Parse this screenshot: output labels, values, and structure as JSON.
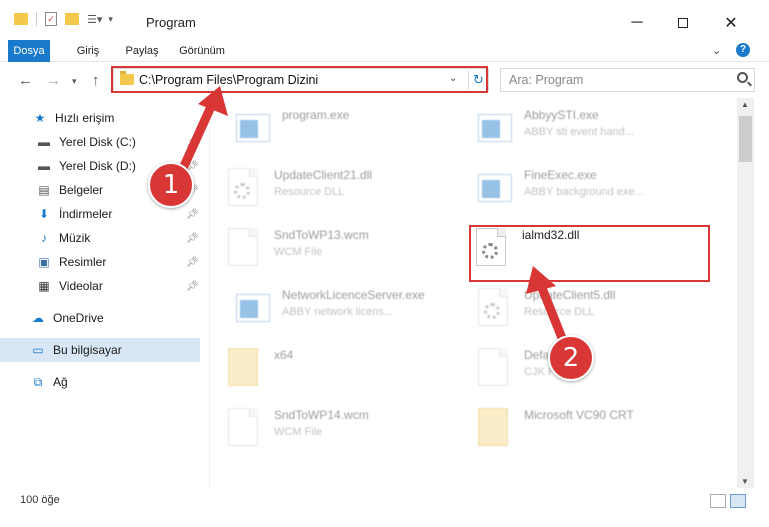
{
  "window": {
    "title": "Program",
    "minimize_icon": "minimize-icon",
    "maximize_icon": "maximize-icon",
    "close_icon": "close-icon"
  },
  "ribbon": {
    "tabs": [
      "Dosya",
      "Giriş",
      "Paylaş",
      "Görünüm"
    ],
    "help": "?"
  },
  "address": {
    "path": "C:\\Program Files\\Program Dizini",
    "search_placeholder": "Ara: Program"
  },
  "sidebar": {
    "items": [
      {
        "label": "Hızlı erişim",
        "icon": "star-icon",
        "pinned": false
      },
      {
        "label": "Yerel Disk (C:)",
        "icon": "drive-icon",
        "pinned": true
      },
      {
        "label": "Yerel Disk (D:)",
        "icon": "drive-icon",
        "pinned": true
      },
      {
        "label": "Belgeler",
        "icon": "documents-icon",
        "pinned": true
      },
      {
        "label": "İndirmeler",
        "icon": "download-icon",
        "pinned": true
      },
      {
        "label": "Müzik",
        "icon": "music-icon",
        "pinned": true
      },
      {
        "label": "Resimler",
        "icon": "pictures-icon",
        "pinned": true
      },
      {
        "label": "Videolar",
        "icon": "video-icon",
        "pinned": true
      },
      {
        "label": "OneDrive",
        "icon": "cloud-icon",
        "pinned": false
      },
      {
        "label": "Bu bilgisayar",
        "icon": "computer-icon",
        "pinned": false,
        "selected": true
      },
      {
        "label": "Ağ",
        "icon": "network-icon",
        "pinned": false
      }
    ]
  },
  "files": [
    {
      "name": "program.exe",
      "desc": "",
      "type": "app"
    },
    {
      "name": "AbbyySTI.exe",
      "desc": "ABBY sti event hand...",
      "type": "app"
    },
    {
      "name": "UpdateClient21.dll",
      "desc": "Resource DLL",
      "type": "dll"
    },
    {
      "name": "FineExec.exe",
      "desc": "ABBY background exe...",
      "type": "app"
    },
    {
      "name": "SndToWP13.wcm",
      "desc": "WCM File",
      "type": "doc"
    },
    {
      "name": "ialmd32.dll",
      "desc": "",
      "type": "dll"
    },
    {
      "name": "NetworkLicenceServer.exe",
      "desc": "ABBY network licens...",
      "type": "app"
    },
    {
      "name": "UpdateClient5.dll",
      "desc": "Resource DLL",
      "type": "dll"
    },
    {
      "name": "x64",
      "desc": "",
      "type": "folder"
    },
    {
      "name": "Default.cjk",
      "desc": "CJK File",
      "type": "doc"
    },
    {
      "name": "SndToWP14.wcm",
      "desc": "WCM File",
      "type": "doc"
    },
    {
      "name": "Microsoft VC90 CRT",
      "desc": "",
      "type": "folder"
    }
  ],
  "status": {
    "count": "100 öğe"
  },
  "callouts": [
    "1",
    "2"
  ],
  "colors": {
    "accent": "#1979ca",
    "highlight": "#d93636",
    "selection": "#d9e6f5"
  }
}
